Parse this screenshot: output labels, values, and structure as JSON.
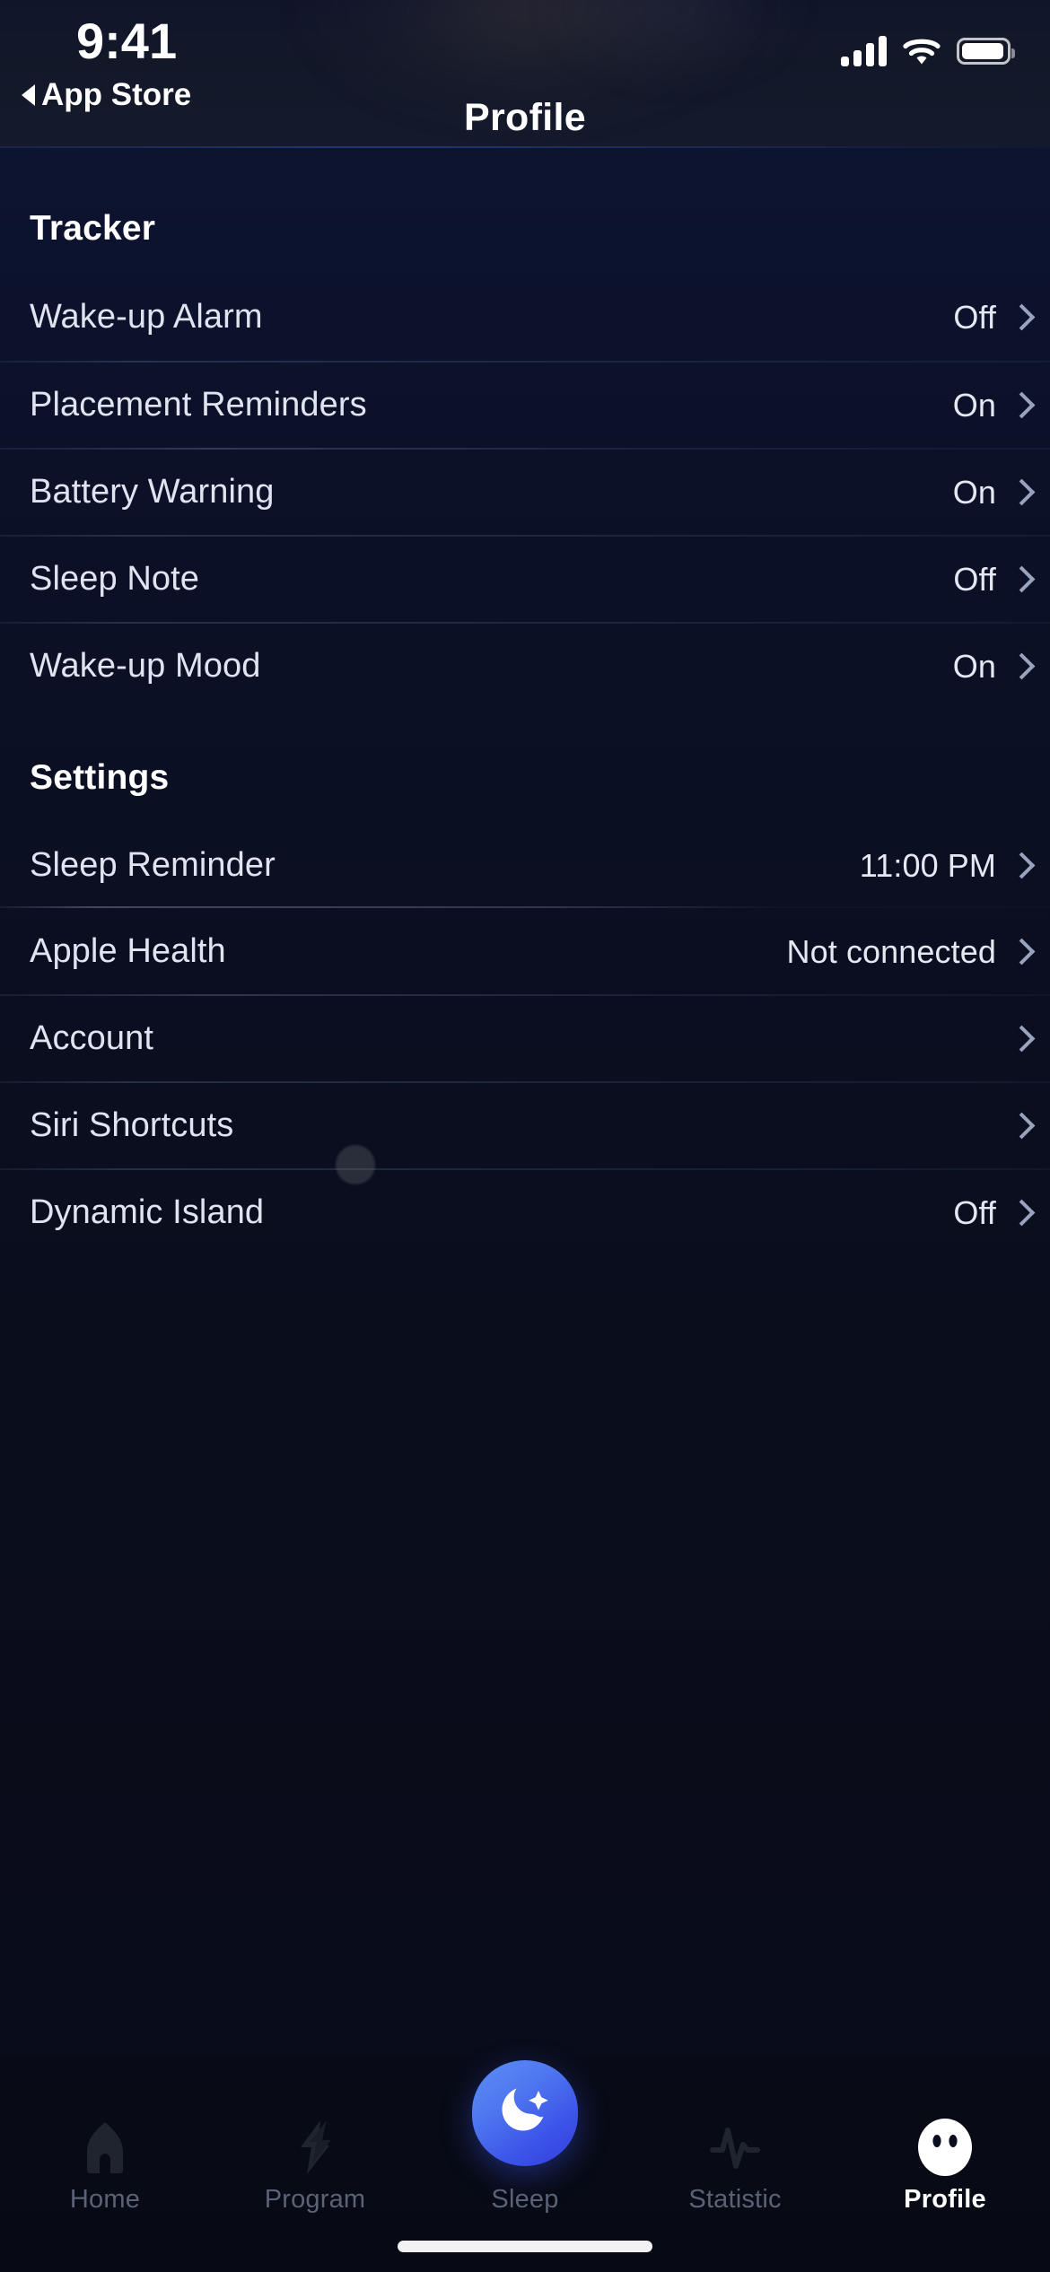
{
  "status_bar": {
    "time": "9:41",
    "back_label": "App Store",
    "back_icon": "triangle-left-icon",
    "cellular_icon": "cellular-bars-icon",
    "wifi_icon": "wifi-icon",
    "battery_icon": "battery-full-icon"
  },
  "header": {
    "title": "Profile"
  },
  "sections": [
    {
      "title": "Tracker",
      "rows": [
        {
          "label": "Wake-up Alarm",
          "value": "Off"
        },
        {
          "label": "Placement Reminders",
          "value": "On"
        },
        {
          "label": "Battery Warning",
          "value": "On"
        },
        {
          "label": "Sleep Note",
          "value": "Off"
        },
        {
          "label": "Wake-up Mood",
          "value": "On"
        }
      ]
    },
    {
      "title": "Settings",
      "rows": [
        {
          "label": "Sleep Reminder",
          "value": "11:00 PM"
        },
        {
          "label": "Apple Health",
          "value": "Not connected"
        },
        {
          "label": "Account",
          "value": ""
        },
        {
          "label": "Siri Shortcuts",
          "value": ""
        },
        {
          "label": "Dynamic Island",
          "value": "Off"
        }
      ]
    }
  ],
  "tab_bar": {
    "items": [
      {
        "label": "Home",
        "icon": "home-icon",
        "active": false
      },
      {
        "label": "Program",
        "icon": "bolt-icon",
        "active": false
      },
      {
        "label": "Sleep",
        "icon": "moon-icon",
        "active": false
      },
      {
        "label": "Statistic",
        "icon": "pulse-icon",
        "active": false
      },
      {
        "label": "Profile",
        "icon": "face-icon",
        "active": true
      }
    ]
  },
  "colors": {
    "background": "#0a0e1e",
    "header_background": "#141a2c",
    "accent_blue": "#3b52e8",
    "accent_blue_light": "#5b8ef5",
    "text_primary": "#ffffff",
    "text_secondary": "#dfe4f0",
    "text_muted": "#5b6275",
    "chevron": "#9aa3bd"
  }
}
